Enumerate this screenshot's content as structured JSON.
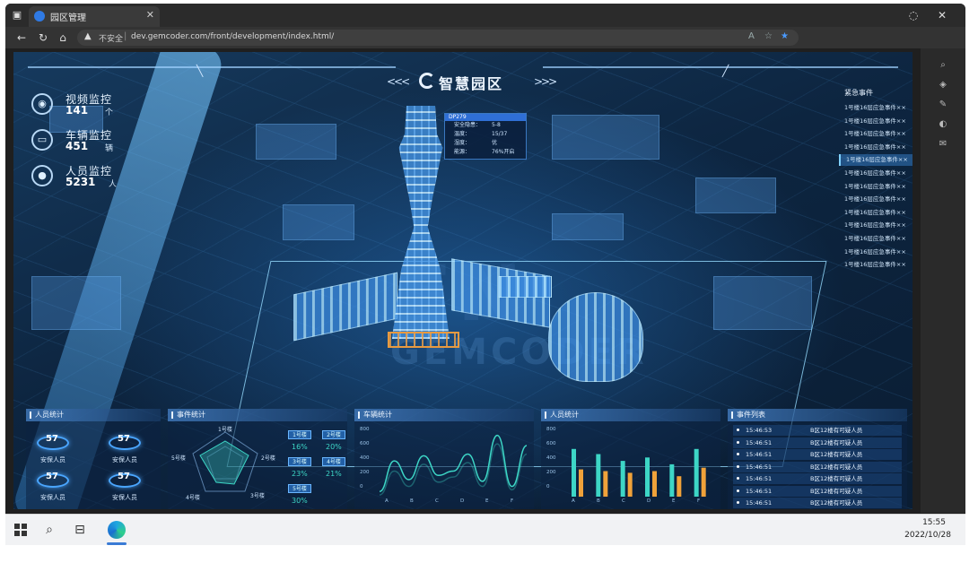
{
  "browser": {
    "tab_title": "园区管理",
    "url_warning": "不安全",
    "url": "dev.gemcoder.com/front/development/index.html/"
  },
  "dashboard": {
    "title": "智慧园区",
    "watermark_big": "EN",
    "watermark": "GEMCODER",
    "stats": [
      {
        "label": "视频监控",
        "value": "141",
        "unit": "个",
        "icon": "camera-icon"
      },
      {
        "label": "车辆监控",
        "value": "451",
        "unit": "辆",
        "icon": "car-icon"
      },
      {
        "label": "人员监控",
        "value": "5231",
        "unit": "人",
        "icon": "person-icon"
      }
    ],
    "popup": {
      "header": "DP279",
      "rows": [
        {
          "k": "安全隐患：",
          "v": "5-8"
        },
        {
          "k": "温度：",
          "v": "15/37"
        },
        {
          "k": "湿度：",
          "v": "优"
        },
        {
          "k": "能源：",
          "v": "76%开启"
        }
      ]
    },
    "events": {
      "title": "紧急事件",
      "items": [
        "1号楼16层应急事件××",
        "1号楼16层应急事件××",
        "1号楼16层应急事件××",
        "1号楼16层应急事件××",
        "1号楼16层应急事件××",
        "1号楼16层应急事件××",
        "1号楼16层应急事件××",
        "1号楼16层应急事件××",
        "1号楼16层应急事件××",
        "1号楼16层应急事件××",
        "1号楼16层应急事件××",
        "1号楼16层应急事件××",
        "1号楼16层应急事件××"
      ],
      "active_index": 4
    },
    "panels": {
      "people": {
        "title": "人员统计",
        "items": [
          {
            "value": "57",
            "label": "安保人员"
          },
          {
            "value": "57",
            "label": "安保人员"
          },
          {
            "value": "57",
            "label": "安保人员"
          },
          {
            "value": "57",
            "label": "安保人员"
          }
        ]
      },
      "incidents": {
        "title": "事件统计",
        "radar_labels": [
          "1号楼",
          "2号楼",
          "3号楼",
          "4号楼",
          "5号楼"
        ],
        "badges": [
          {
            "label": "1号楼",
            "pct": "16%"
          },
          {
            "label": "2号楼",
            "pct": "20%"
          },
          {
            "label": "3号楼",
            "pct": "23%"
          },
          {
            "label": "4号楼",
            "pct": "21%"
          },
          {
            "label": "5号楼",
            "pct": "30%"
          }
        ]
      },
      "vehicles": {
        "title": "车辆统计",
        "y_ticks": [
          "800",
          "600",
          "400",
          "200",
          "0"
        ],
        "x_ticks": [
          "A",
          "B",
          "C",
          "D",
          "E",
          "F"
        ]
      },
      "persons": {
        "title": "人员统计",
        "y_ticks": [
          "800",
          "600",
          "400",
          "200",
          "0"
        ],
        "x_ticks": [
          "A",
          "B",
          "C",
          "D",
          "E",
          "F"
        ]
      },
      "event_list": {
        "title": "事件列表",
        "rows": [
          {
            "time": "15:46:53",
            "text": "B区12楼有可疑人员"
          },
          {
            "time": "15:46:51",
            "text": "B区12楼有可疑人员"
          },
          {
            "time": "15:46:51",
            "text": "B区12楼有可疑人员"
          },
          {
            "time": "15:46:51",
            "text": "B区12楼有可疑人员"
          },
          {
            "time": "15:46:51",
            "text": "B区12楼有可疑人员"
          },
          {
            "time": "15:46:51",
            "text": "B区12楼有可疑人员"
          },
          {
            "time": "15:46:51",
            "text": "B区12楼有可疑人员"
          }
        ]
      }
    }
  },
  "chart_data": [
    {
      "type": "line",
      "title": "车辆统计",
      "x": [
        "A",
        "B",
        "C",
        "D",
        "E",
        "F"
      ],
      "ylim": [
        0,
        800
      ],
      "series": [
        {
          "values": [
            60,
            420,
            200,
            480,
            250,
            300,
            500,
            180,
            720,
            120,
            600
          ]
        },
        {
          "values": [
            20,
            300,
            120,
            380,
            170,
            230,
            400,
            120,
            620,
            80,
            500
          ]
        }
      ]
    },
    {
      "type": "bar",
      "title": "人员统计",
      "categories": [
        "A",
        "B",
        "C",
        "D",
        "E",
        "F"
      ],
      "ylim": [
        0,
        800
      ],
      "series": [
        {
          "values": [
            560,
            500,
            420,
            460,
            380,
            560
          ]
        },
        {
          "values": [
            320,
            300,
            280,
            300,
            240,
            340
          ]
        }
      ]
    }
  ],
  "taskbar": {
    "time": "15:55",
    "date": "2022/10/28"
  }
}
